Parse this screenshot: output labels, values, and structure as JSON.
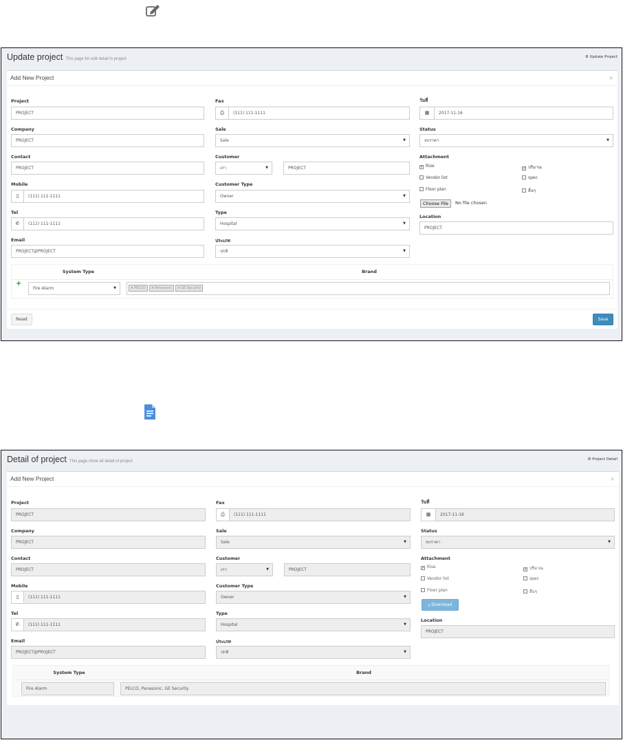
{
  "update": {
    "header_title": "Update project",
    "header_subtitle": "This page for edit detail in project",
    "breadcrumb": "Update Project",
    "box_title": "Add New Project",
    "labels": {
      "project": "Project",
      "company": "Company",
      "contact": "Contact",
      "mobile": "Mobile",
      "tel": "Tel",
      "email": "Email",
      "fax": "Fax",
      "sale": "Sale",
      "customer": "Customer",
      "customer_type": "Customer Type",
      "type": "Type",
      "country": "ประเภท",
      "date": "วันที่",
      "status": "Status",
      "attachment": "Attachment",
      "location": "Location"
    },
    "values": {
      "project": "PROJECT",
      "company": "PROJECT",
      "contact": "PROJECT",
      "mobile": "(111) 111-1111",
      "tel": "(111) 111-1111",
      "email": "PROJECT@PROJECT",
      "fax": "(111) 111-1111",
      "sale": "Sale",
      "customer_select": "เก่า",
      "customer_name": "PROJECT",
      "customer_type": "Owner",
      "type": "Hospital",
      "country": "ปกติ",
      "date": "2017-11-16",
      "status": "จบราคา",
      "location": "PROJECT"
    },
    "attachments": [
      "Rise",
      "ปริมาณ",
      "Vendor list",
      "spec",
      "Floor plan",
      "อื่นๆ"
    ],
    "file_button": "Choose File",
    "file_status": "No file chosen",
    "table": {
      "col_system": "System Type",
      "col_brand": "Brand",
      "system_value": "Fire Alarm",
      "brands": [
        "PELCO",
        "Panasonic",
        "GE Security"
      ]
    },
    "reset_label": "Reset",
    "save_label": "Save"
  },
  "detail": {
    "header_title": "Detail of project",
    "header_subtitle": "This page show all detail of project",
    "breadcrumb": "Project Detail",
    "box_title": "Add New Project",
    "download_label": "Download",
    "table": {
      "system_value": "Fire Alarm",
      "brand_value": "PELCO, Panasonic, GE Security"
    }
  },
  "icons": {
    "top": "edit-icon",
    "middle": "document-icon",
    "mobile": "mobile-icon",
    "tel": "phone-icon",
    "fax": "fax-icon",
    "date": "calendar-icon",
    "breadcrumb": "gear-icon",
    "add_row": "plus-icon",
    "close": "close-icon",
    "download": "download-icon"
  },
  "colors": {
    "primary": "#3c8dbc",
    "info": "#7cb6dc",
    "add": "#2e8b2e",
    "panel_bg": "#ecf0f5",
    "readonly_bg": "#eeeeee"
  }
}
